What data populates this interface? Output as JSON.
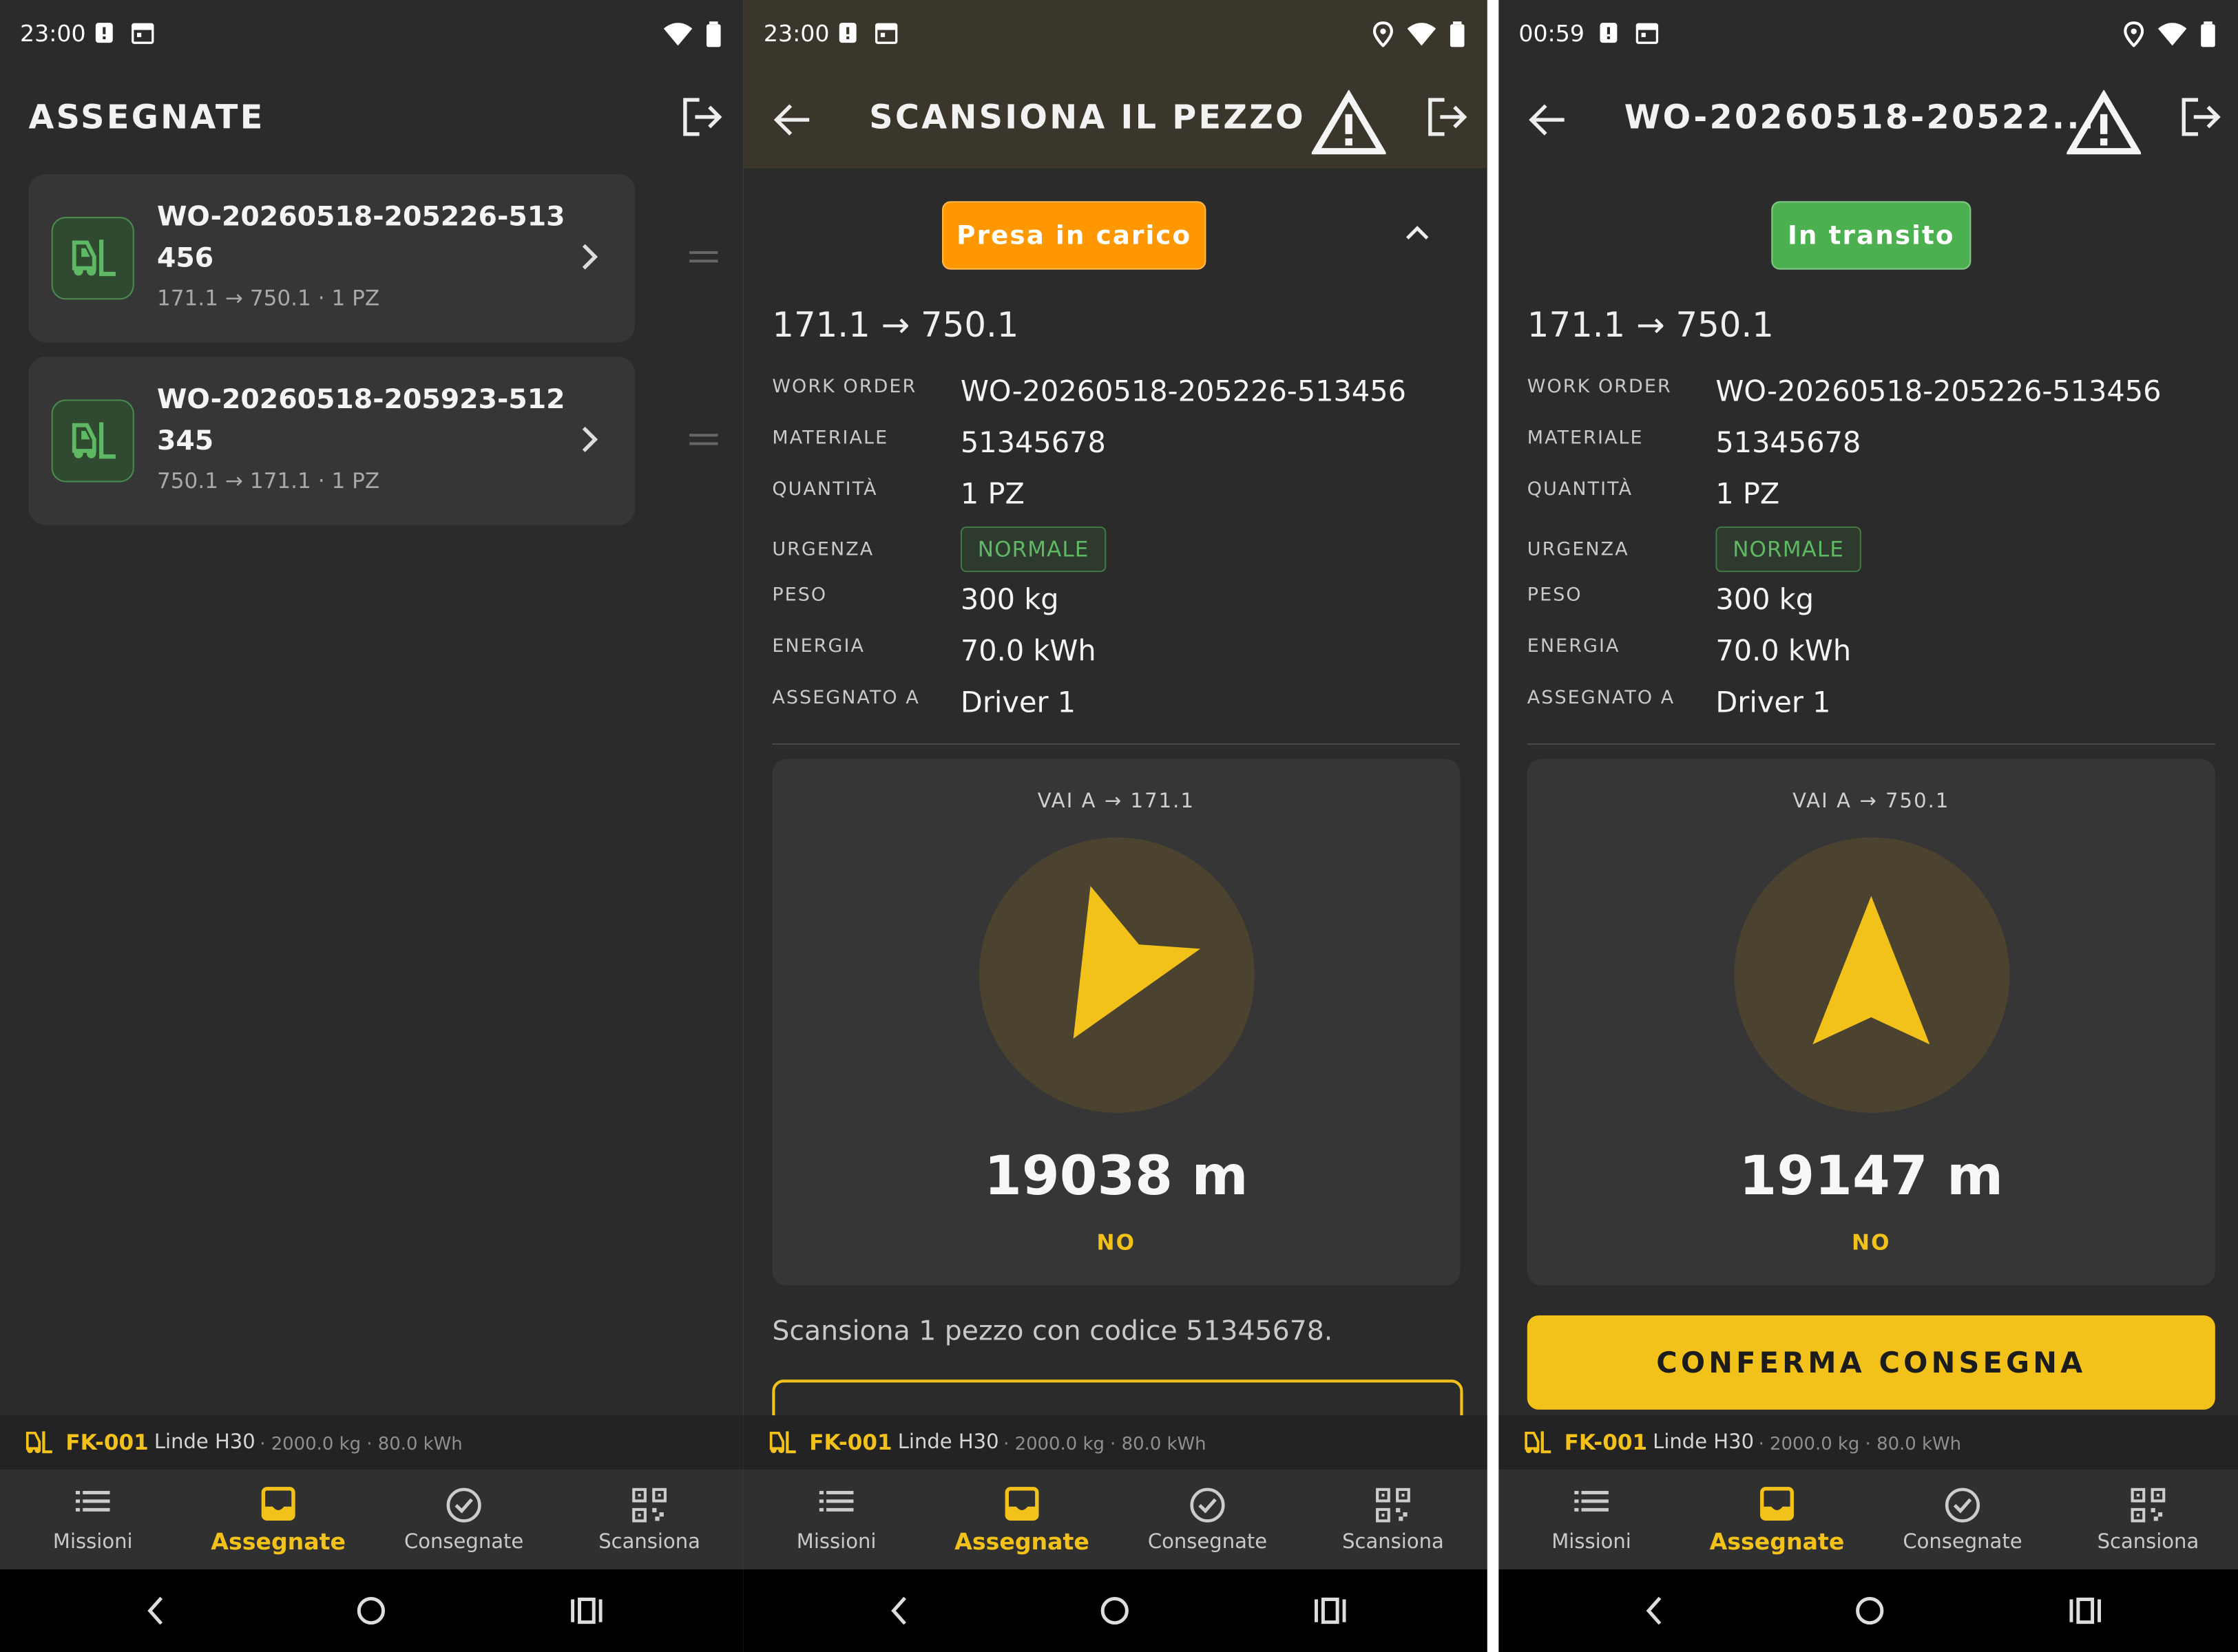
{
  "colors": {
    "accent": "#f2c21b",
    "orange": "#ff9800",
    "green": "#4caf50",
    "bg": "#2b2b2b"
  },
  "screens": [
    {
      "status": {
        "time": "23:00"
      },
      "title": "ASSEGNATE",
      "cards": [
        {
          "wo": "WO-20260518-205226-513456",
          "route": "171.1 → 750.1 · 1 PZ"
        },
        {
          "wo": "WO-20260518-205923-512345",
          "route": "750.1 → 171.1 · 1 PZ"
        }
      ]
    },
    {
      "status": {
        "time": "23:00"
      },
      "title": "SCANSIONA IL PEZZO",
      "badge": "Presa in carico",
      "route": "171.1 → 750.1",
      "details": {
        "work_order_label": "WORK ORDER",
        "work_order": "WO-20260518-205226-513456",
        "materiale_label": "MATERIALE",
        "materiale": "51345678",
        "quantita_label": "QUANTITÀ",
        "quantita": "1 PZ",
        "urgenza_label": "URGENZA",
        "urgenza": "NORMALE",
        "peso_label": "PESO",
        "peso": "300 kg",
        "energia_label": "ENERGIA",
        "energia": "70.0 kWh",
        "assegnato_label": "ASSEGNATO A",
        "assegnato": "Driver 1"
      },
      "nav": {
        "goto": "VAI A → 171.1",
        "distance": "19038 m",
        "direction": "NO"
      },
      "hint": "Scansiona 1 pezzo con codice 51345678."
    },
    {
      "status": {
        "time": "00:59"
      },
      "title": "WO-20260518-20522...",
      "badge": "In transito",
      "route": "171.1 → 750.1",
      "details": {
        "work_order_label": "WORK ORDER",
        "work_order": "WO-20260518-205226-513456",
        "materiale_label": "MATERIALE",
        "materiale": "51345678",
        "quantita_label": "QUANTITÀ",
        "quantita": "1 PZ",
        "urgenza_label": "URGENZA",
        "urgenza": "NORMALE",
        "peso_label": "PESO",
        "peso": "300 kg",
        "energia_label": "ENERGIA",
        "energia": "70.0 kWh",
        "assegnato_label": "ASSEGNATO A",
        "assegnato": "Driver 1"
      },
      "nav": {
        "goto": "VAI A → 750.1",
        "distance": "19147 m",
        "direction": "NO"
      },
      "confirm": "CONFERMA CONSEGNA"
    }
  ],
  "vehicle": {
    "id": "FK-001",
    "model": "Linde H30",
    "specs": "· 2000.0 kg · 80.0 kWh"
  },
  "tabs": [
    "Missioni",
    "Assegnate",
    "Consegnate",
    "Scansiona"
  ],
  "active_tab": "Assegnate",
  "icons": [
    "forklift-icon",
    "logout-icon",
    "back-arrow-icon",
    "warning-icon",
    "chevron-right-icon",
    "drag-handle-icon",
    "chevron-up-icon",
    "list-icon",
    "inbox-icon",
    "check-circle-icon",
    "qr-code-icon",
    "wifi-icon",
    "battery-icon",
    "location-icon"
  ]
}
